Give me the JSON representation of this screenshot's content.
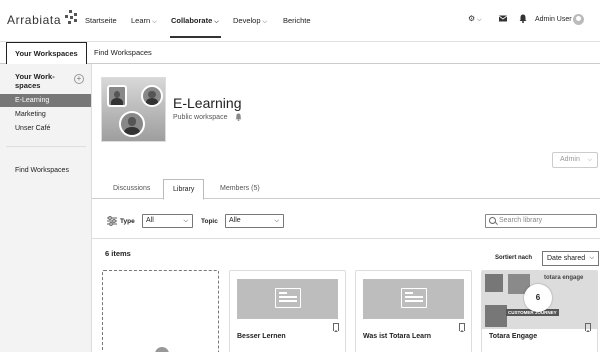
{
  "app": {
    "logo_text": "Arrabiata"
  },
  "topnav": {
    "items": [
      {
        "label": "Startseite",
        "has_caret": false
      },
      {
        "label": "Learn",
        "has_caret": true
      },
      {
        "label": "Collaborate",
        "has_caret": true,
        "active": true
      },
      {
        "label": "Develop",
        "has_caret": true
      },
      {
        "label": "Berichte",
        "has_caret": false
      }
    ],
    "user_name": "Admin User"
  },
  "workspace_tabs": [
    {
      "label": "Your Workspaces",
      "active": true
    },
    {
      "label": "Find Workspaces",
      "active": false
    }
  ],
  "sidebar": {
    "title": "Your Work-spaces",
    "items": [
      {
        "label": "E-Learning",
        "active": true
      },
      {
        "label": "Marketing",
        "active": false
      },
      {
        "label": "Unser Café",
        "active": false
      }
    ],
    "find_label": "Find Workspaces"
  },
  "workspace": {
    "title": "E-Learning",
    "subtitle": "Public workspace",
    "admin_button": "Admin"
  },
  "content_tabs": [
    {
      "label": "Discussions",
      "active": false
    },
    {
      "label": "Library",
      "active": true
    },
    {
      "label": "Members (5)",
      "active": false
    }
  ],
  "filters": {
    "type_label": "Type",
    "type_value": "All",
    "topic_label": "Topic",
    "topic_value": "Alle",
    "search_placeholder": "Search library"
  },
  "library": {
    "count_label": "6 items",
    "sort_label": "Sortiert nach",
    "sort_value": "Date shared",
    "cards": [
      {
        "title": "",
        "kind": "add"
      },
      {
        "title": "Besser Lernen",
        "kind": "resource"
      },
      {
        "title": "Was ist Totara Learn",
        "kind": "resource"
      },
      {
        "title": "Totara Engage",
        "kind": "playlist",
        "badge": "6",
        "brand": "totara engage",
        "banner": "CUSTOMER JOURNEY"
      }
    ]
  },
  "colors": {
    "active_sidebar": "#777777",
    "text": "#222222",
    "thumb": "#bdbdbd"
  }
}
